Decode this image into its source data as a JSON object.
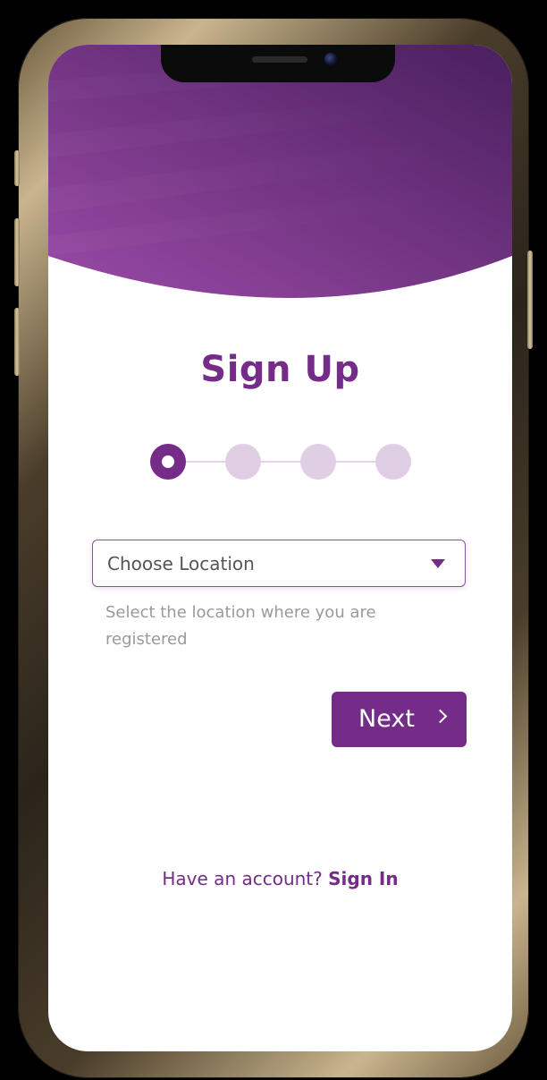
{
  "colors": {
    "brand": "#742c88",
    "step_inactive": "#e0cfe4",
    "helper_text": "#9a9a9a",
    "header_gradient_start": "#4a1f5f",
    "header_gradient_end": "#9a4aa6"
  },
  "page": {
    "title": "Sign Up"
  },
  "stepper": {
    "total_steps": 4,
    "current_step": 1
  },
  "location_select": {
    "value": "Choose Location",
    "icon": "caret-down-icon"
  },
  "helper_text": "Select the location where you are registered",
  "next_button": {
    "label": "Next",
    "icon": "chevron-right-icon"
  },
  "footer": {
    "prompt": "Have an account?",
    "link": "Sign In"
  }
}
